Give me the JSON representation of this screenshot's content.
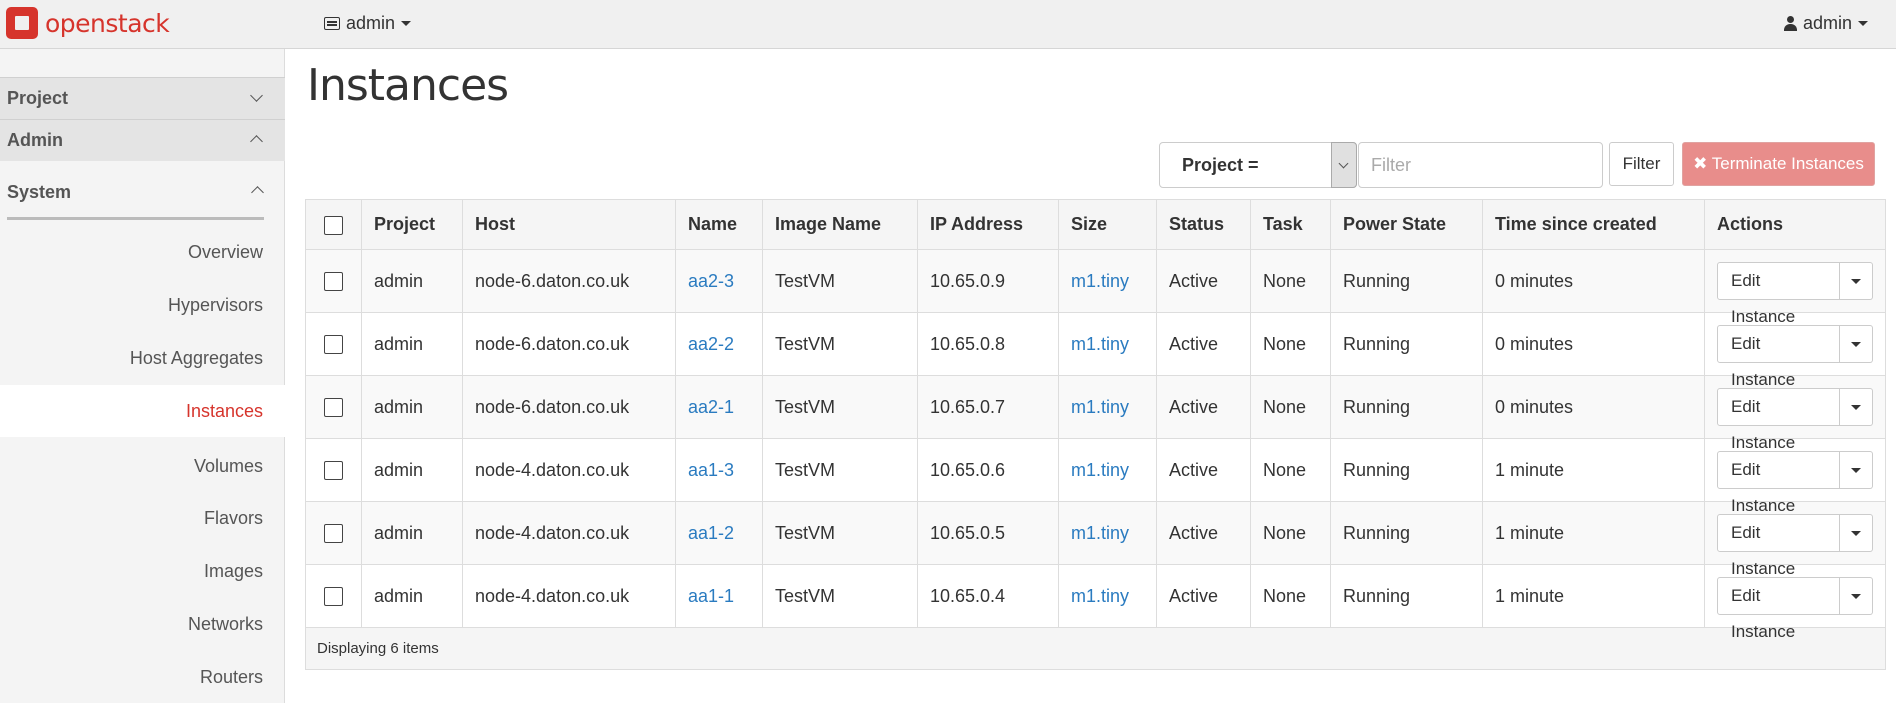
{
  "header": {
    "brand": "openstack",
    "project_switch": "admin",
    "user_menu": "admin"
  },
  "sidebar": {
    "sections": [
      {
        "label": "Project",
        "expanded": false
      },
      {
        "label": "Admin",
        "expanded": true
      }
    ],
    "panel_group": "System",
    "items": [
      {
        "label": "Overview"
      },
      {
        "label": "Hypervisors"
      },
      {
        "label": "Host Aggregates"
      },
      {
        "label": "Instances",
        "active": true
      },
      {
        "label": "Volumes"
      },
      {
        "label": "Flavors"
      },
      {
        "label": "Images"
      },
      {
        "label": "Networks"
      },
      {
        "label": "Routers"
      }
    ]
  },
  "main": {
    "title": "Instances",
    "filter": {
      "selected": "Project =",
      "placeholder": "Filter",
      "button": "Filter"
    },
    "terminate_button": "✖ Terminate Instances",
    "columns": [
      "Project",
      "Host",
      "Name",
      "Image Name",
      "IP Address",
      "Size",
      "Status",
      "Task",
      "Power State",
      "Time since created",
      "Actions"
    ],
    "rows": [
      {
        "project": "admin",
        "host": "node-6.daton.co.uk",
        "name": "aa2-3",
        "image": "TestVM",
        "ip": "10.65.0.9",
        "size": "m1.tiny",
        "status": "Active",
        "task": "None",
        "power": "Running",
        "age": "0 minutes",
        "action": "Edit Instance"
      },
      {
        "project": "admin",
        "host": "node-6.daton.co.uk",
        "name": "aa2-2",
        "image": "TestVM",
        "ip": "10.65.0.8",
        "size": "m1.tiny",
        "status": "Active",
        "task": "None",
        "power": "Running",
        "age": "0 minutes",
        "action": "Edit Instance"
      },
      {
        "project": "admin",
        "host": "node-6.daton.co.uk",
        "name": "aa2-1",
        "image": "TestVM",
        "ip": "10.65.0.7",
        "size": "m1.tiny",
        "status": "Active",
        "task": "None",
        "power": "Running",
        "age": "0 minutes",
        "action": "Edit Instance"
      },
      {
        "project": "admin",
        "host": "node-4.daton.co.uk",
        "name": "aa1-3",
        "image": "TestVM",
        "ip": "10.65.0.6",
        "size": "m1.tiny",
        "status": "Active",
        "task": "None",
        "power": "Running",
        "age": "1 minute",
        "action": "Edit Instance"
      },
      {
        "project": "admin",
        "host": "node-4.daton.co.uk",
        "name": "aa1-2",
        "image": "TestVM",
        "ip": "10.65.0.5",
        "size": "m1.tiny",
        "status": "Active",
        "task": "None",
        "power": "Running",
        "age": "1 minute",
        "action": "Edit Instance"
      },
      {
        "project": "admin",
        "host": "node-4.daton.co.uk",
        "name": "aa1-1",
        "image": "TestVM",
        "ip": "10.65.0.4",
        "size": "m1.tiny",
        "status": "Active",
        "task": "None",
        "power": "Running",
        "age": "1 minute",
        "action": "Edit Instance"
      }
    ],
    "footer": "Displaying 6 items"
  },
  "colors": {
    "brand": "#d6342c",
    "link": "#2a7bc0",
    "danger_button": "#e88d8b"
  }
}
